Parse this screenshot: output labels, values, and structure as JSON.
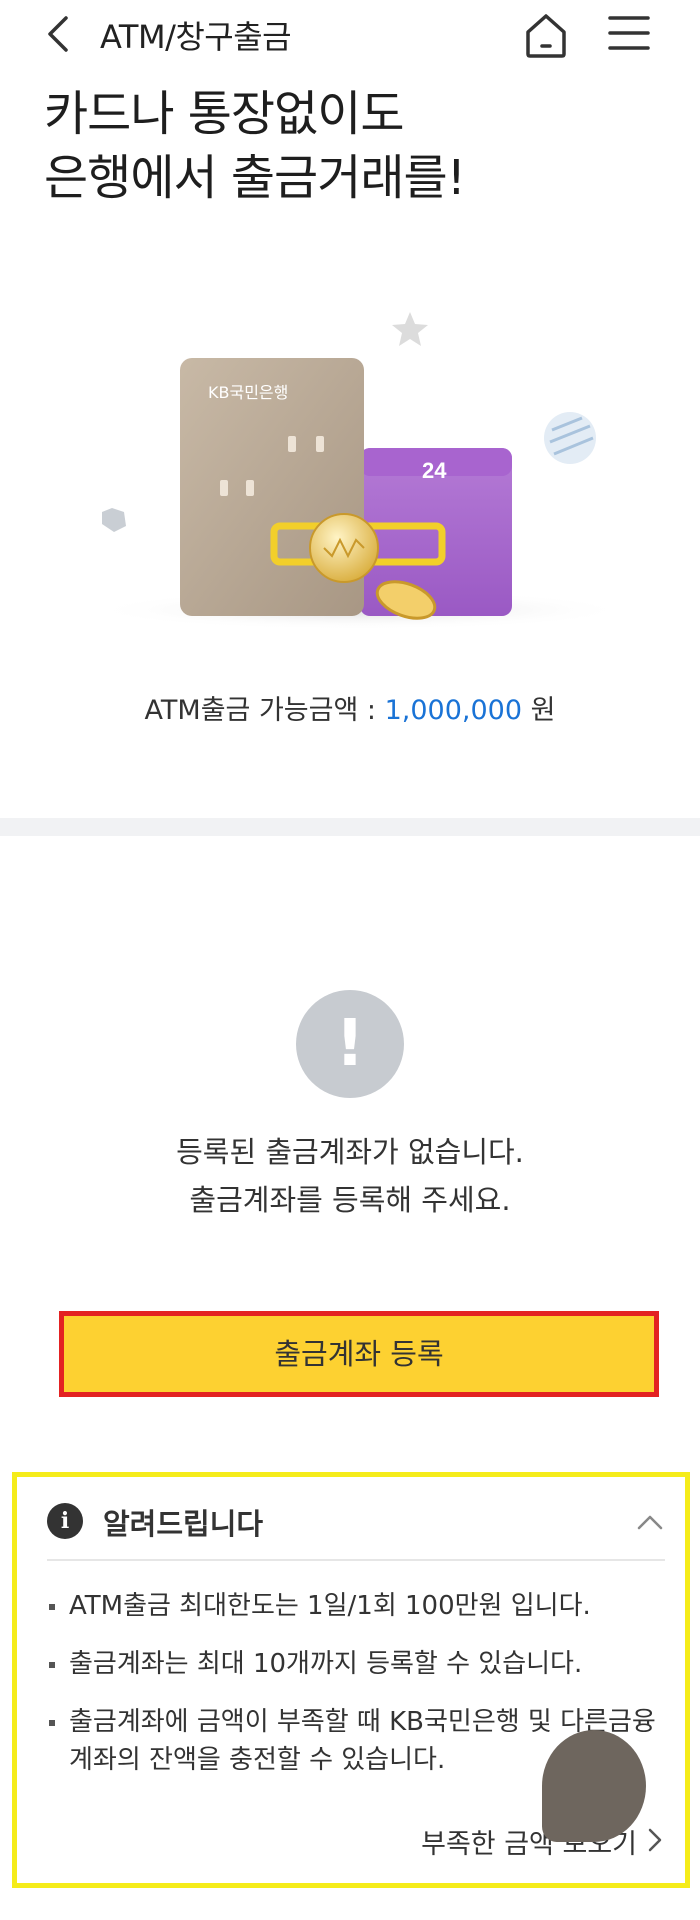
{
  "header": {
    "title": "ATM/창구출금",
    "back_icon": "chevron-left-icon",
    "home_icon": "home-icon",
    "menu_icon": "hamburger-menu-icon"
  },
  "hero": {
    "title_line1": "카드나 통장없이도",
    "title_line2": "은행에서 출금거래를!",
    "card_brand": "KB국민은행",
    "calendar_day": "24"
  },
  "limit": {
    "label": "ATM출금 가능금액 :",
    "amount": "1,000,000",
    "unit": "원"
  },
  "empty_state": {
    "icon": "exclamation-icon",
    "line1": "등록된 출금계좌가 없습니다.",
    "line2": "출금계좌를 등록해 주세요."
  },
  "register_button": {
    "label": "출금계좌 등록"
  },
  "notice": {
    "title": "알려드립니다",
    "info_icon_glyph": "i",
    "items": [
      "ATM출금 최대한도는 1일/1회 100만원 입니다.",
      "출금계좌는 최대 10개까지 등록할 수 있습니다.",
      "출금계좌에 금액이 부족할 때 KB국민은행 및 다른금융 계좌의 잔액을 충전할 수 있습니다."
    ],
    "more_link": "부족한 금액 보오기"
  },
  "colors": {
    "accent_yellow": "#fdd131",
    "amount_blue": "#1a73d6",
    "highlight_red": "#e32222",
    "highlight_yellow": "#f5ec1a"
  }
}
